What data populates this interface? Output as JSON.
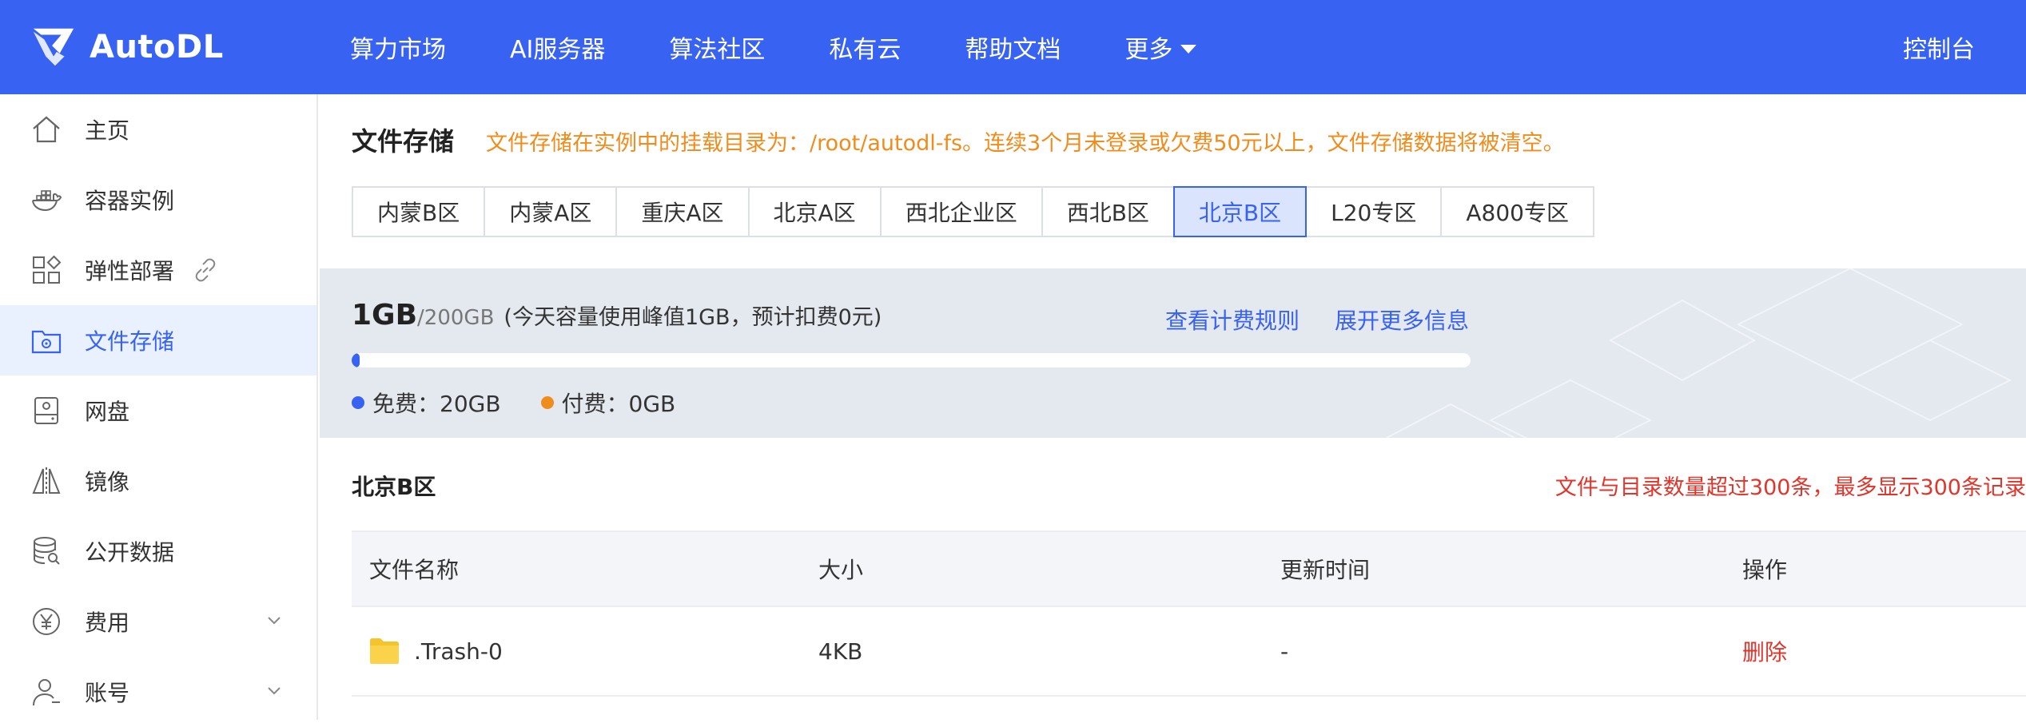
{
  "brand": {
    "name": "AutoDL",
    "accent": "#3862f2"
  },
  "nav": {
    "items": [
      "算力市场",
      "AI服务器",
      "算法社区",
      "私有云",
      "帮助文档",
      "更多"
    ],
    "console": "控制台"
  },
  "sidebar": {
    "items": [
      {
        "label": "主页",
        "icon": "home-icon"
      },
      {
        "label": "容器实例",
        "icon": "docker-icon"
      },
      {
        "label": "弹性部署",
        "icon": "apps-icon"
      },
      {
        "label": "文件存储",
        "icon": "folder-settings-icon"
      },
      {
        "label": "网盘",
        "icon": "disk-icon"
      },
      {
        "label": "镜像",
        "icon": "mirror-icon"
      },
      {
        "label": "公开数据",
        "icon": "database-icon"
      },
      {
        "label": "费用",
        "icon": "yen-icon"
      },
      {
        "label": "账号",
        "icon": "user-icon"
      }
    ],
    "active": "文件存储"
  },
  "page": {
    "title": "文件存储",
    "notice": "文件存储在实例中的挂载目录为：/root/autodl-fs。连续3个月未登录或欠费50元以上，文件存储数据将被清空。"
  },
  "tabs": {
    "items": [
      "内蒙B区",
      "内蒙A区",
      "重庆A区",
      "北京A区",
      "西北企业区",
      "西北B区",
      "北京B区",
      "L20专区",
      "A800专区"
    ],
    "active": "北京B区"
  },
  "usage": {
    "used": "1GB",
    "quota": "/200GB",
    "peak_note": "(今天容量使用峰值1GB，预计扣费0元)",
    "link_billing": "查看计费规则",
    "link_more": "展开更多信息",
    "fraction": 0.005,
    "free_label": "免费：20GB",
    "paid_label": "付费：0GB",
    "free_color": "#3862f2",
    "paid_color": "#f08c1c"
  },
  "region": {
    "name": "北京B区",
    "limit_note": "文件与目录数量超过300条，最多显示300条记录"
  },
  "table": {
    "headers": [
      "文件名称",
      "大小",
      "更新时间",
      "操作"
    ],
    "rows": [
      {
        "name": ".Trash-0",
        "size": "4KB",
        "updated": "-",
        "action": "删除"
      }
    ]
  }
}
